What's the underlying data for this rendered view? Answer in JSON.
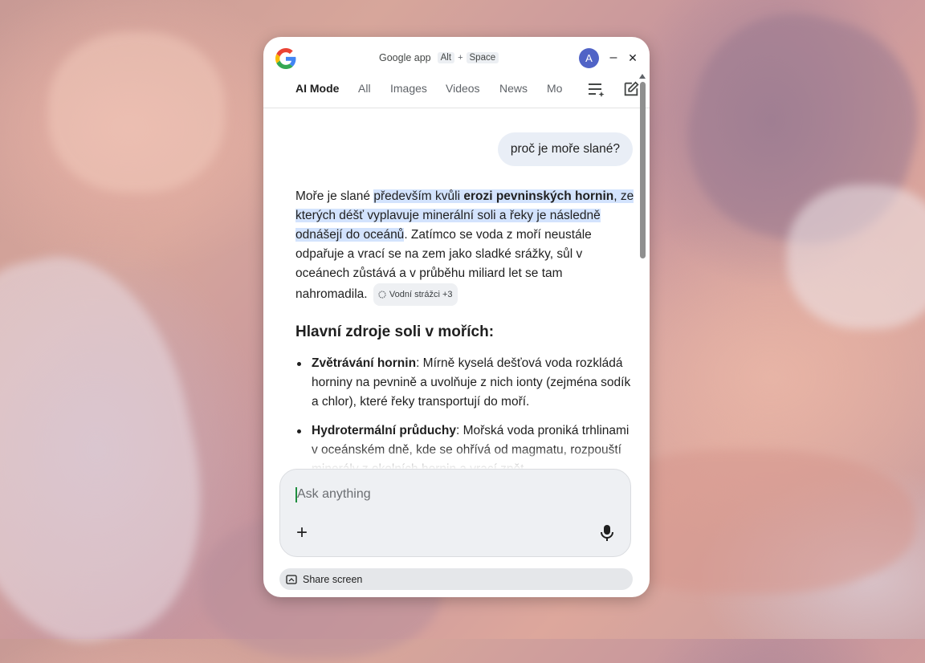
{
  "window": {
    "title": "Google app",
    "shortcut_key1": "Alt",
    "shortcut_plus": "+",
    "shortcut_key2": "Space",
    "avatar_letter": "A",
    "minimize_glyph": "–",
    "close_glyph": "✕"
  },
  "tabs": [
    {
      "label": "AI Mode",
      "active": true
    },
    {
      "label": "All"
    },
    {
      "label": "Images"
    },
    {
      "label": "Videos"
    },
    {
      "label": "News"
    },
    {
      "label": "Mo"
    }
  ],
  "conversation": {
    "user_query": "proč je moře slané?",
    "answer": {
      "p1": "Moře je slané ",
      "hl1": "především kvůli ",
      "hl1_bold": "erozi pevninských hornin",
      "hl2": ", ze kterých déšť vyplavuje minerální soli a řeky je následně odnášejí do oceánů",
      "p2": ". Zatímco se voda z moří neustále odpařuje a vrací se na zem jako sladké srážky, sůl v oceánech zůstává a v průběhu miliard let se tam nahromadila.",
      "source_chip": "Vodní strážci +3"
    },
    "heading": "Hlavní zdroje soli v mořích:",
    "bullets": [
      {
        "title": "Zvětrávání hornin",
        "text": ": Mírně kyselá dešťová voda rozkládá horniny na pevnině a uvolňuje z nich ionty (zejména sodík a chlor), které řeky transportují do moří."
      },
      {
        "title": "Hydrotermální průduchy",
        "text": ": Mořská voda proniká trhlinami v oceánském dně, kde se ohřívá od magmatu, rozpouští minerály z okolních hornin a vrací zpět."
      }
    ]
  },
  "input": {
    "placeholder": "Ask anything",
    "add_glyph": "+"
  },
  "share": {
    "label": "Share screen"
  },
  "icons": {
    "logo": "google-g-logo",
    "filter": "filter-sparkle-icon",
    "edit": "new-chat-edit-icon",
    "mic": "microphone-icon",
    "share": "share-screen-icon"
  },
  "colors": {
    "accent_blue": "#4285F4",
    "avatar_bg": "#5063c6",
    "highlight": "#d3e3fd"
  }
}
